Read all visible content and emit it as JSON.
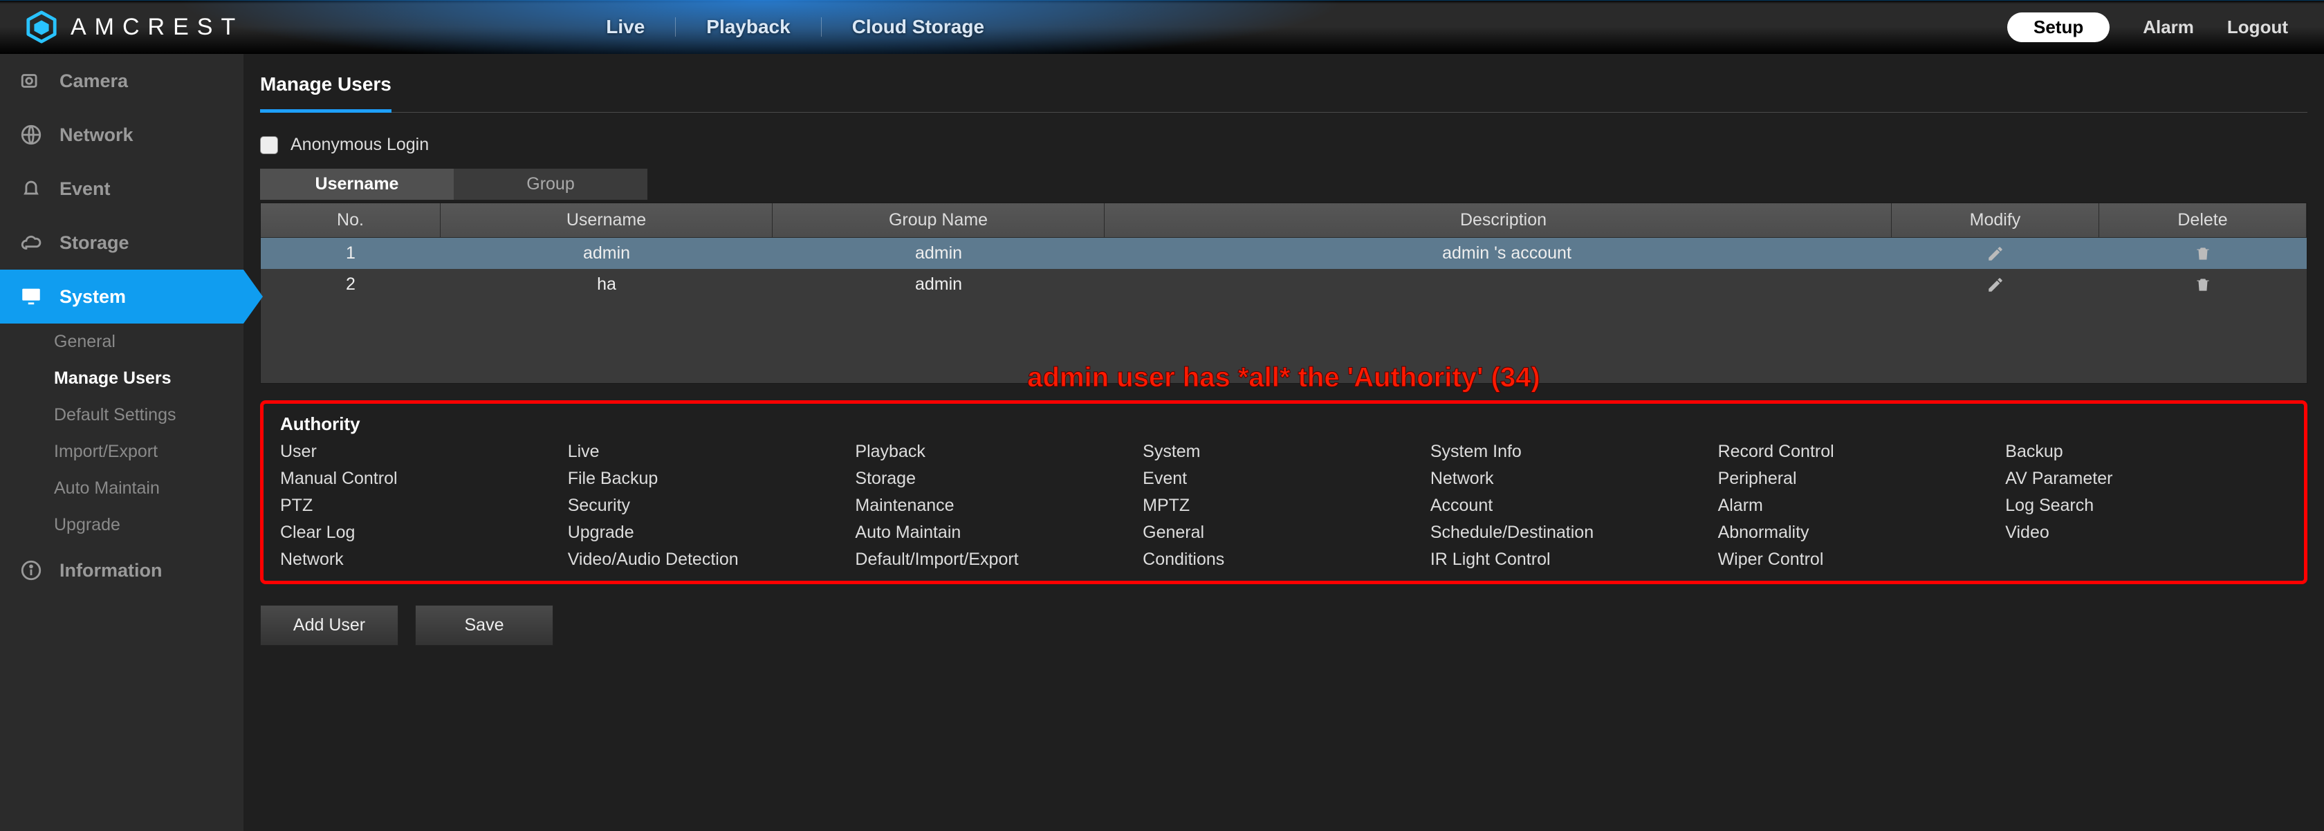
{
  "brand": {
    "name": "AMCREST"
  },
  "topnav": {
    "live": "Live",
    "playback": "Playback",
    "cloud": "Cloud Storage"
  },
  "rightnav": {
    "setup": "Setup",
    "alarm": "Alarm",
    "logout": "Logout"
  },
  "sidebar": {
    "items": [
      {
        "label": "Camera"
      },
      {
        "label": "Network"
      },
      {
        "label": "Event"
      },
      {
        "label": "Storage"
      },
      {
        "label": "System",
        "active": true
      },
      {
        "label": "Information"
      }
    ],
    "system_sub": [
      {
        "label": "General"
      },
      {
        "label": "Manage Users",
        "active": true
      },
      {
        "label": "Default Settings"
      },
      {
        "label": "Import/Export"
      },
      {
        "label": "Auto Maintain"
      },
      {
        "label": "Upgrade"
      }
    ]
  },
  "section": {
    "title": "Manage Users"
  },
  "anon": {
    "label": "Anonymous Login"
  },
  "subtabs": {
    "username": "Username",
    "group": "Group"
  },
  "table": {
    "headers": {
      "no": "No.",
      "username": "Username",
      "group": "Group Name",
      "desc": "Description",
      "modify": "Modify",
      "delete": "Delete"
    },
    "rows": [
      {
        "no": "1",
        "username": "admin",
        "group": "admin",
        "desc": "admin 's account",
        "selected": true
      },
      {
        "no": "2",
        "username": "ha",
        "group": "admin",
        "desc": ""
      }
    ]
  },
  "annotation": "admin user has *all* the 'Authority' (34)",
  "authority": {
    "title": "Authority",
    "items": [
      "User",
      "Live",
      "Playback",
      "System",
      "System Info",
      "Record Control",
      "Backup",
      "Manual Control",
      "File Backup",
      "Storage",
      "Event",
      "Network",
      "Peripheral",
      "AV Parameter",
      "PTZ",
      "Security",
      "Maintenance",
      "MPTZ",
      "Account",
      "Alarm",
      "Log Search",
      "Clear Log",
      "Upgrade",
      "Auto Maintain",
      "General",
      "Schedule/Destination",
      "Abnormality",
      "Video",
      "Network",
      "Video/Audio Detection",
      "Default/Import/Export",
      "Conditions",
      "IR Light Control",
      "Wiper Control"
    ]
  },
  "buttons": {
    "add": "Add User",
    "save": "Save"
  }
}
